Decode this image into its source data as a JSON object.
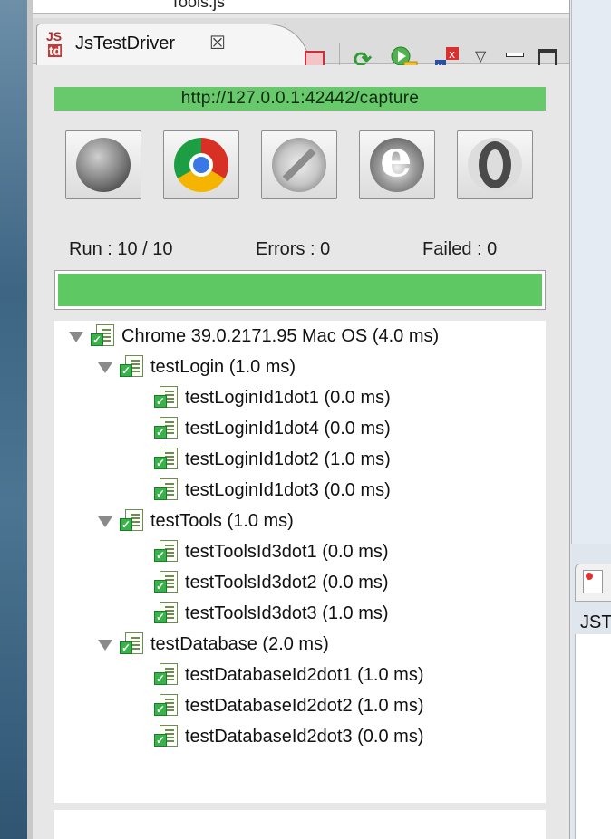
{
  "previous_view": {
    "item_label": "Tools.js"
  },
  "view": {
    "title": "JsTestDriver",
    "icon_text_top": "JS",
    "icon_text_bottom": "td",
    "close_glyph": "☒"
  },
  "toolbar": {
    "icons": [
      "stop-icon",
      "rerun-icon",
      "run-config-icon",
      "show-failures-icon",
      "view-menu-icon",
      "minimize-icon",
      "maximize-icon"
    ],
    "rerun_glyph": "⟳",
    "view_menu_glyph": "▽"
  },
  "capture_url": "http://127.0.0.1:42442/capture",
  "browsers": [
    "firefox-icon",
    "chrome-icon",
    "safari-icon",
    "internet-explorer-icon",
    "opera-icon"
  ],
  "stats": {
    "run": "Run : 10 / 10",
    "errors": "Errors : 0",
    "failed": "Failed : 0"
  },
  "progress": {
    "fraction": 1.0,
    "color": "#5ec962"
  },
  "tree": [
    {
      "label": "Chrome 39.0.2171.95 Mac OS (4.0 ms)",
      "level": 0,
      "expanded": true
    },
    {
      "label": "testLogin (1.0 ms)",
      "level": 1,
      "expanded": true
    },
    {
      "label": "testLoginId1dot1 (0.0 ms)",
      "level": 2
    },
    {
      "label": "testLoginId1dot4 (0.0 ms)",
      "level": 2
    },
    {
      "label": "testLoginId1dot2 (1.0 ms)",
      "level": 2
    },
    {
      "label": "testLoginId1dot3 (0.0 ms)",
      "level": 2
    },
    {
      "label": "testTools (1.0 ms)",
      "level": 1,
      "expanded": true
    },
    {
      "label": "testToolsId3dot1 (0.0 ms)",
      "level": 2
    },
    {
      "label": "testToolsId3dot2 (0.0 ms)",
      "level": 2
    },
    {
      "label": "testToolsId3dot3 (1.0 ms)",
      "level": 2
    },
    {
      "label": "testDatabase (2.0 ms)",
      "level": 1,
      "expanded": true
    },
    {
      "label": "testDatabaseId2dot1 (1.0 ms)",
      "level": 2
    },
    {
      "label": "testDatabaseId2dot2 (1.0 ms)",
      "level": 2
    },
    {
      "label": "testDatabaseId2dot3 (0.0 ms)",
      "level": 2
    }
  ],
  "right_window": {
    "label": "JST"
  },
  "colors": {
    "capture_bar": "#67c96b",
    "pass_green": "#37b34a",
    "stop_red": "#c9303b"
  }
}
